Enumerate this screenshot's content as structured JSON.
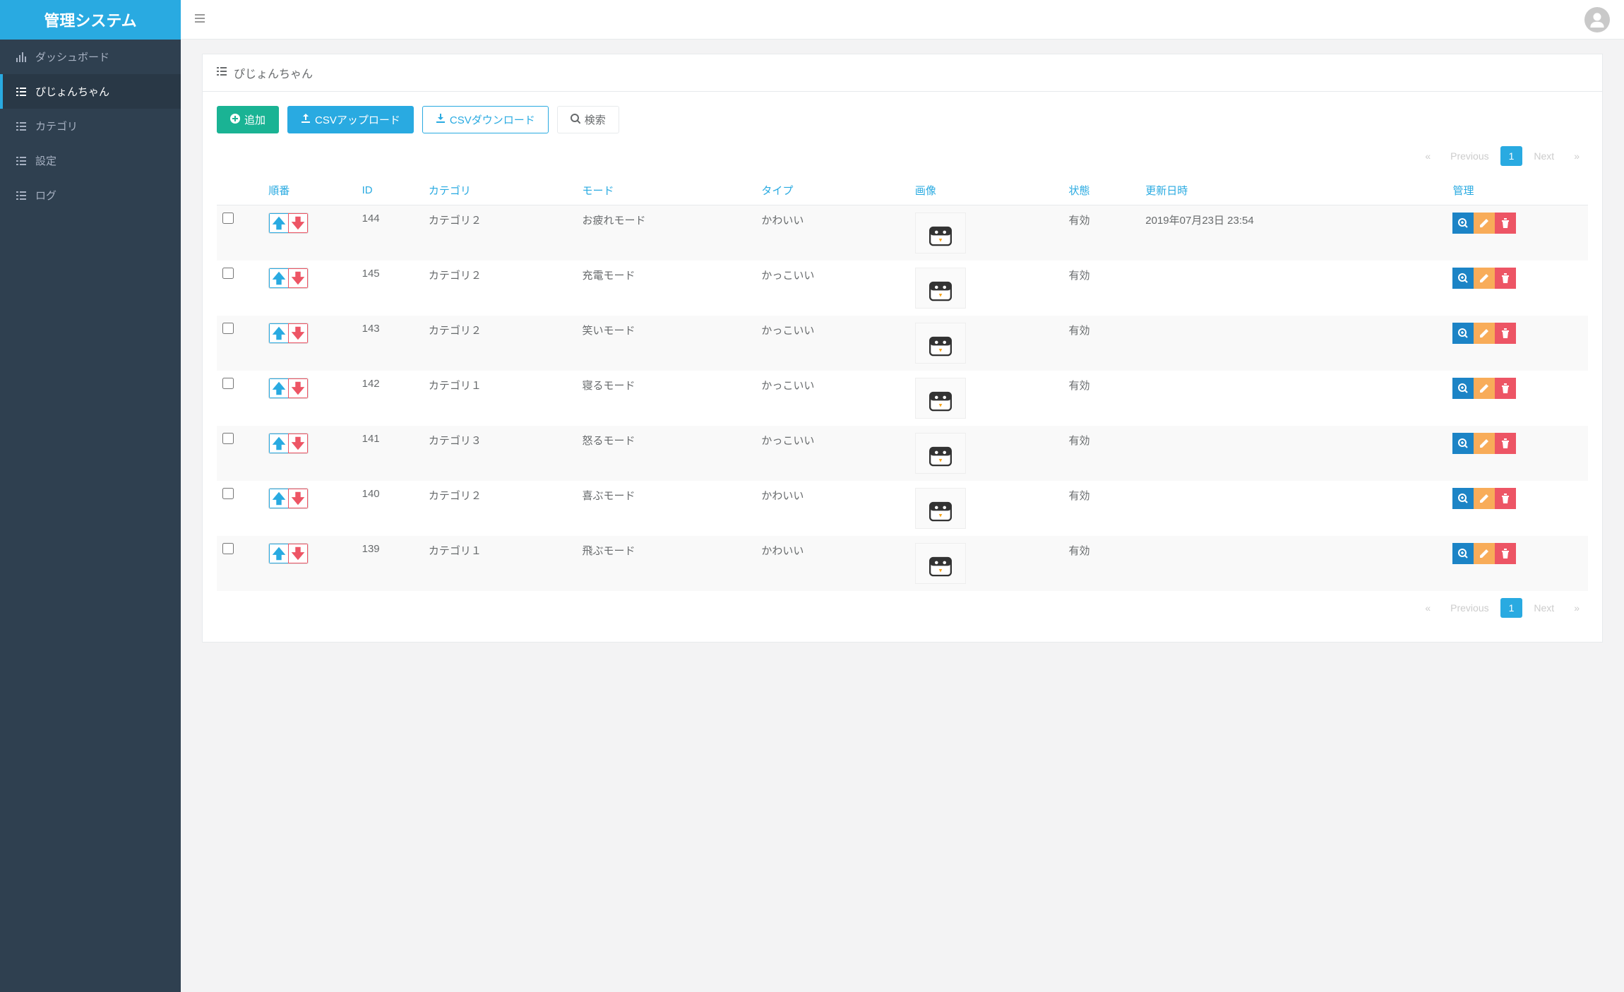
{
  "brand": "管理システム",
  "sidebar": {
    "items": [
      {
        "label": "ダッシュボード",
        "icon": "chart-bar",
        "active": false
      },
      {
        "label": "ぴじょんちゃん",
        "icon": "list",
        "active": true
      },
      {
        "label": "カテゴリ",
        "icon": "list",
        "active": false
      },
      {
        "label": "設定",
        "icon": "list",
        "active": false
      },
      {
        "label": "ログ",
        "icon": "list",
        "active": false
      }
    ]
  },
  "page": {
    "title": "ぴじょんちゃん"
  },
  "toolbar": {
    "add": "追加",
    "csv_upload": "CSVアップロード",
    "csv_download": "CSVダウンロード",
    "search": "検索"
  },
  "pagination": {
    "first": "«",
    "prev": "Previous",
    "page": "1",
    "next": "Next",
    "last": "»"
  },
  "table": {
    "headers": {
      "order": "順番",
      "id": "ID",
      "category": "カテゴリ",
      "mode": "モード",
      "type": "タイプ",
      "image": "画像",
      "status": "状態",
      "updated": "更新日時",
      "manage": "管理"
    },
    "rows": [
      {
        "id": "144",
        "category": "カテゴリ２",
        "mode": "お疲れモード",
        "type": "かわいい",
        "status": "有効",
        "updated": "2019年07月23日 23:54"
      },
      {
        "id": "145",
        "category": "カテゴリ２",
        "mode": "充電モード",
        "type": "かっこいい",
        "status": "有効",
        "updated": ""
      },
      {
        "id": "143",
        "category": "カテゴリ２",
        "mode": "笑いモード",
        "type": "かっこいい",
        "status": "有効",
        "updated": ""
      },
      {
        "id": "142",
        "category": "カテゴリ１",
        "mode": "寝るモード",
        "type": "かっこいい",
        "status": "有効",
        "updated": ""
      },
      {
        "id": "141",
        "category": "カテゴリ３",
        "mode": "怒るモード",
        "type": "かっこいい",
        "status": "有効",
        "updated": ""
      },
      {
        "id": "140",
        "category": "カテゴリ２",
        "mode": "喜ぶモード",
        "type": "かわいい",
        "status": "有効",
        "updated": ""
      },
      {
        "id": "139",
        "category": "カテゴリ１",
        "mode": "飛ぶモード",
        "type": "かわいい",
        "status": "有効",
        "updated": ""
      }
    ]
  }
}
